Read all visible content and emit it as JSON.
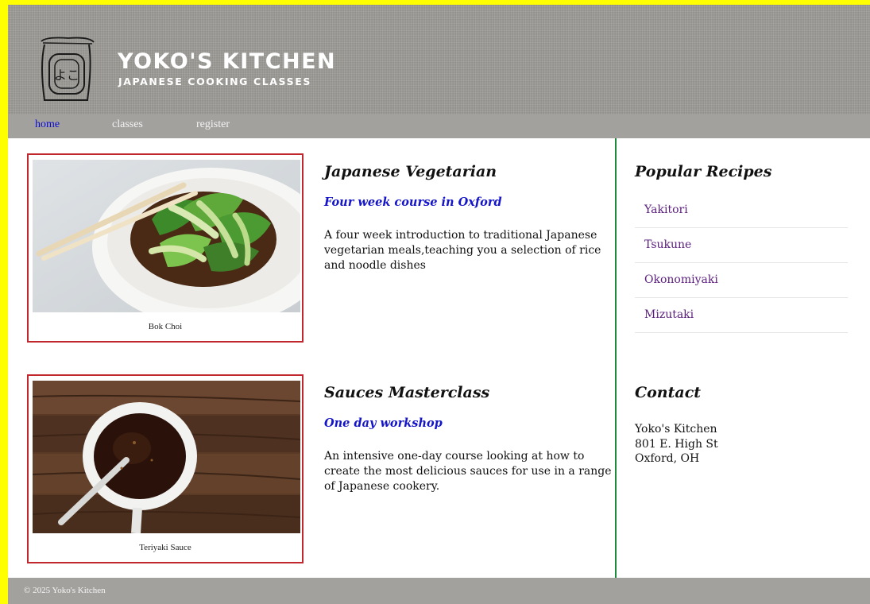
{
  "brand": {
    "title": "YOKO'S KITCHEN",
    "subtitle": "JAPANESE COOKING CLASSES",
    "logo_text": "よこ"
  },
  "nav": {
    "items": [
      {
        "label": "home",
        "active": true
      },
      {
        "label": "classes",
        "active": false
      },
      {
        "label": "register",
        "active": false
      }
    ]
  },
  "courses": [
    {
      "image_caption": "Bok Choi",
      "title": "Japanese Vegetarian",
      "subtitle": "Four week course in Oxford",
      "description": "A four week introduction to traditional Japanese vegetarian meals,teaching you a selection of rice and noodle dishes"
    },
    {
      "image_caption": "Teriyaki Sauce",
      "title": "Sauces Masterclass",
      "subtitle": "One day workshop",
      "description": "An intensive one-day course looking at how to create the most delicious sauces for use in a range of Japanese cookery."
    }
  ],
  "sidebar": {
    "recipes_title": "Popular Recipes",
    "recipes": [
      "Yakitori",
      "Tsukune",
      "Okonomiyaki",
      "Mizutaki"
    ],
    "contact_title": "Contact",
    "contact_lines": [
      "Yoko's Kitchen",
      "801 E. High St",
      "Oxford, OH"
    ]
  },
  "footer": {
    "copyright": "© 2025 Yoko's Kitchen"
  },
  "colors": {
    "page_border": "#ffff00",
    "header_bg": "#9a9893",
    "nav_bg": "#a3a19e",
    "nav_active": "#0a0ad0",
    "figure_border": "#c0282d",
    "subtitle_blue": "#1414c8",
    "recipe_link": "#5a1e7d",
    "divider_green": "#1e8a3c"
  }
}
